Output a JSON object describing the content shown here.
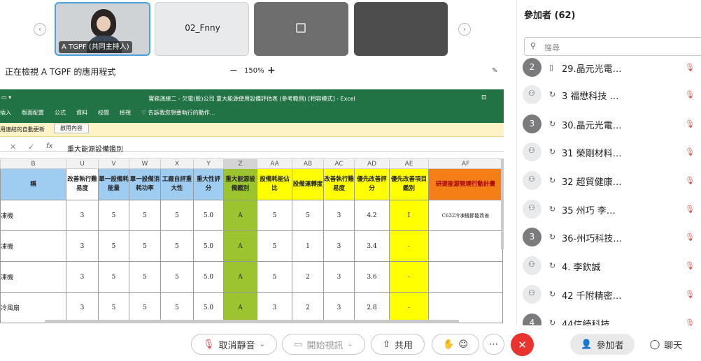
{
  "video_strip": {
    "tiles": [
      {
        "label": "A TGPF (共同主持人)"
      },
      {
        "label": "02_Fnny"
      },
      {
        "label": ""
      },
      {
        "label": ""
      }
    ]
  },
  "share": {
    "viewing_text": "正在檢視 A TGPF 的應用程式",
    "zoom": "150%",
    "zoom_minus": "−",
    "zoom_plus": "+"
  },
  "excel": {
    "title": "實務演練二 - 欠電(股)公司 重大能源使用設備評估表 (參考範例) [相容模式] - Excel",
    "ribbon": [
      "插入",
      "版面配置",
      "公式",
      "資料",
      "校閱",
      "檢視",
      "♡ 告訴我您想要執行的動作..."
    ],
    "notice_text": "用連結的自動更新",
    "notice_button": "啟用內容",
    "formula_value": "重大能源設備鑑別",
    "fx": "fx",
    "col_letters": [
      "B",
      "U",
      "V",
      "W",
      "X",
      "Y",
      "Z",
      "AA",
      "AB",
      "AC",
      "AD",
      "AE",
      "AF"
    ],
    "headers": [
      "稱",
      "改善執行難易度",
      "單一設備耗能量",
      "單一設備消耗功率",
      "工廠自評重大性",
      "重大性評分",
      "重大能源設備鑑別",
      "設備耗能佔比",
      "設備運轉度",
      "改善執行難易度",
      "優先改善評分",
      "優先改善項目鑑別",
      "研提能源管理行動計畫"
    ],
    "rows": [
      [
        "凍機",
        "3",
        "5",
        "5",
        "5",
        "5.0",
        "A",
        "5",
        "5",
        "3",
        "4.2",
        "I",
        "C632冷凍機節能改善"
      ],
      [
        "凍機",
        "3",
        "5",
        "5",
        "5",
        "5.0",
        "A",
        "5",
        "1",
        "3",
        "3.4",
        "-",
        ""
      ],
      [
        "凍機",
        "3",
        "5",
        "5",
        "5",
        "5.0",
        "A",
        "5",
        "2",
        "3",
        "3.6",
        "-",
        ""
      ],
      [
        "冷風扇",
        "3",
        "5",
        "5",
        "5",
        "5.0",
        "A",
        "3",
        "2",
        "3",
        "2.8",
        "-",
        ""
      ]
    ]
  },
  "participants": {
    "title": "參加者 (62)",
    "search_placeholder": "搜尋",
    "list": [
      {
        "avatar": "2",
        "name": "29.晶元光電…"
      },
      {
        "avatar": "",
        "name": "3 福懋科技 …"
      },
      {
        "avatar": "3",
        "name": "30.晶元光電…"
      },
      {
        "avatar": "",
        "name": "31 榮剛材料…"
      },
      {
        "avatar": "",
        "name": "32 超貿健康…"
      },
      {
        "avatar": "",
        "name": "35 州巧 李…"
      },
      {
        "avatar": "3",
        "name": "36-州巧科技…"
      },
      {
        "avatar": "",
        "name": "4. 李欽誠"
      },
      {
        "avatar": "",
        "name": "42 千附精密…"
      },
      {
        "avatar": "4",
        "name": "44信綺科技…"
      }
    ]
  },
  "toolbar": {
    "unmute": "取消靜音",
    "start_video": "開始視訊",
    "share": "共用",
    "participants": "參加者",
    "chat": "聊天"
  }
}
